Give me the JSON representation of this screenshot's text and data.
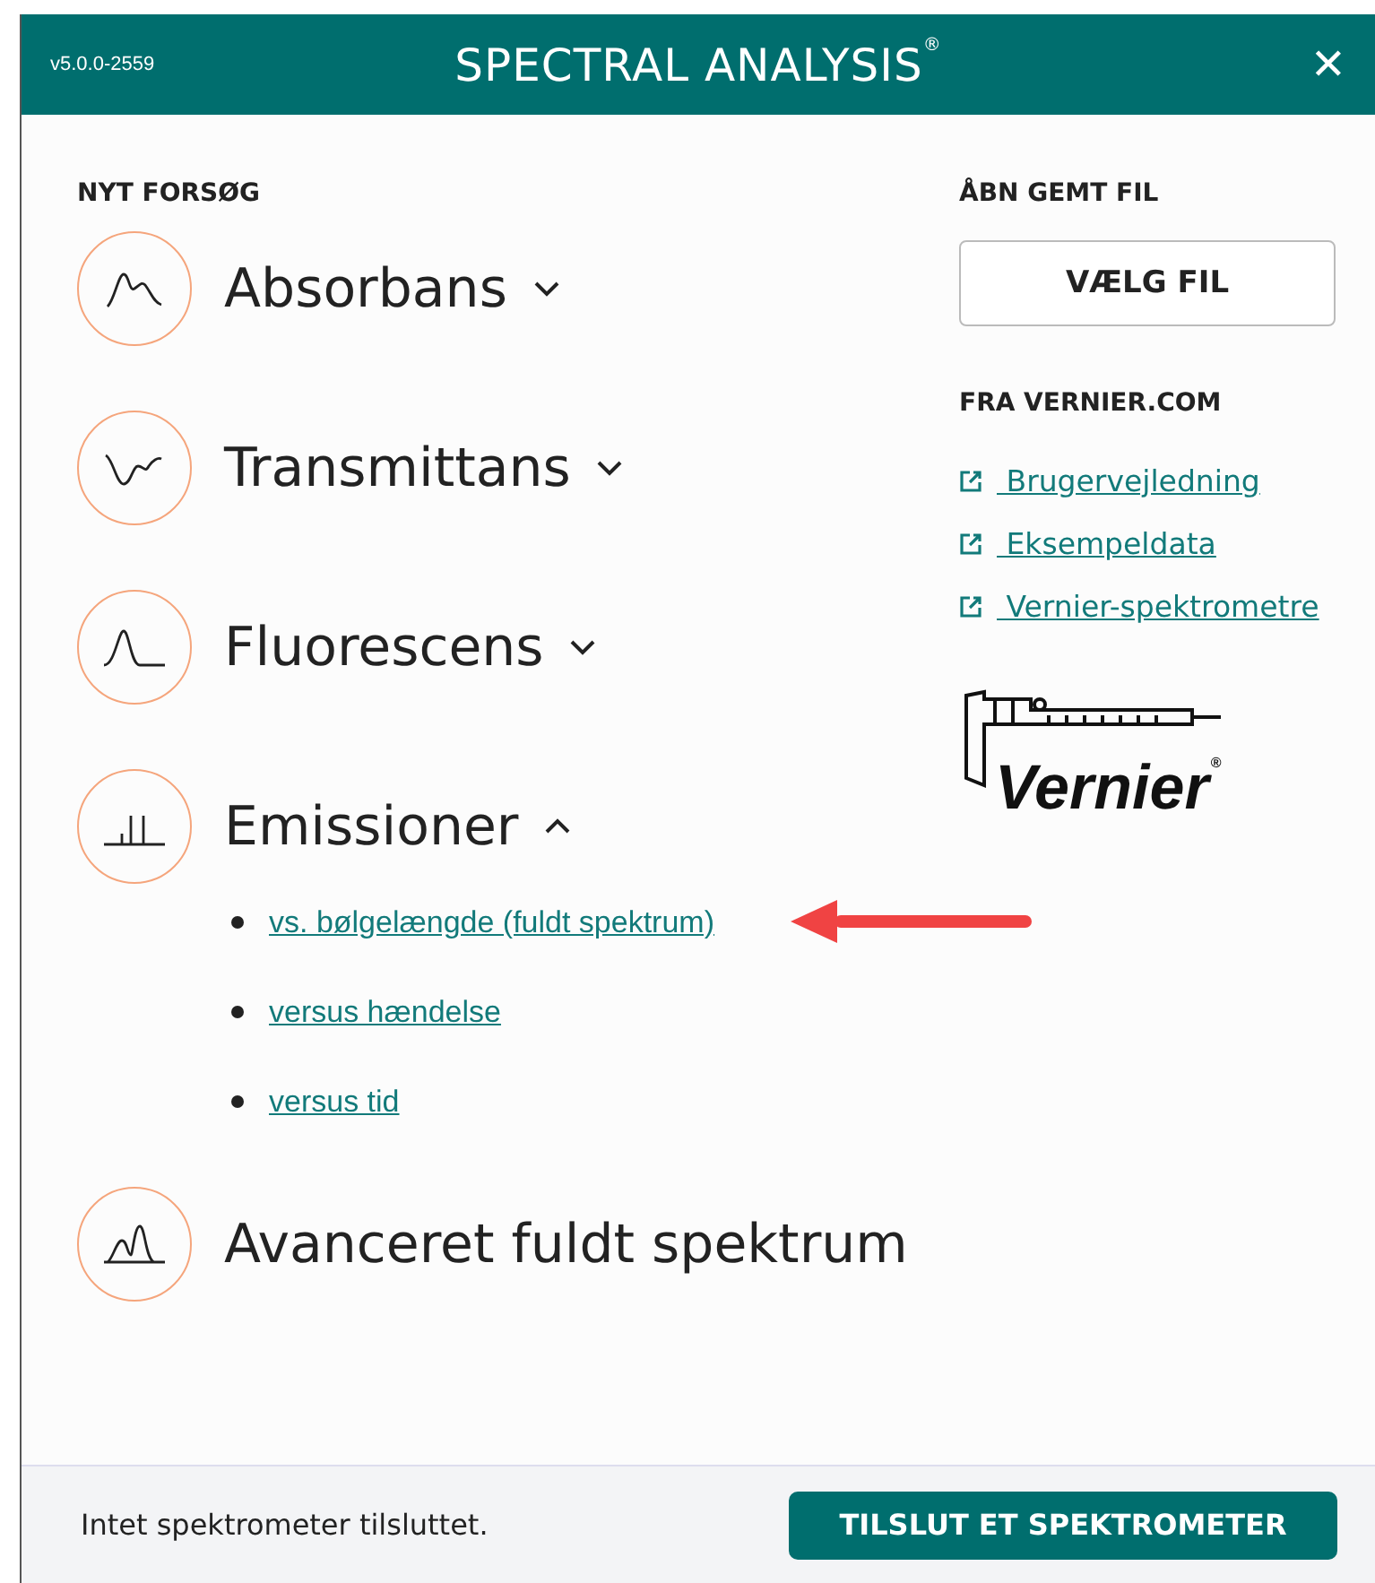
{
  "header": {
    "version": "v5.0.0-2559",
    "title": "SPECTRAL ANALYSIS",
    "title_mark": "®",
    "close": "✕"
  },
  "new_experiment": {
    "heading": "NYT FORSØG",
    "items": [
      {
        "kind": "absorbance",
        "label": "Absorbans",
        "expanded": false
      },
      {
        "kind": "transmittance",
        "label": "Transmittans",
        "expanded": false
      },
      {
        "kind": "fluorescence",
        "label": "Fluorescens",
        "expanded": false
      },
      {
        "kind": "emission",
        "label": "Emissioner",
        "expanded": true,
        "children": [
          {
            "label": "vs. bølgelængde (fuldt spektrum)",
            "annotated": true
          },
          {
            "label": "versus hændelse",
            "annotated": false
          },
          {
            "label": "versus tid",
            "annotated": false
          }
        ]
      },
      {
        "kind": "advanced",
        "label": "Avanceret fuldt spektrum"
      }
    ]
  },
  "open_saved": {
    "heading": "ÅBN GEMT FIL",
    "button": "VÆLG FIL"
  },
  "from_vernier": {
    "heading": "FRA VERNIER.COM",
    "links": [
      "Brugervejledning",
      "Eksempeldata",
      "Vernier-spektrometre"
    ]
  },
  "logo": {
    "text": "Vernier",
    "mark": "®"
  },
  "footer": {
    "status": "Intet spektrometer tilsluttet.",
    "button": "TILSLUT ET SPEKTROMETER"
  }
}
